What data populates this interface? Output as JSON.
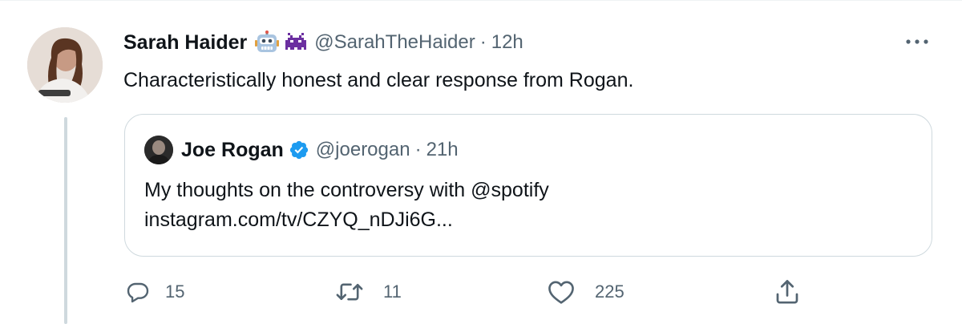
{
  "tweet": {
    "author_name": "Sarah Haider",
    "author_emojis": [
      "robot-face-emoji",
      "alien-monster-emoji"
    ],
    "author_handle": "@SarahTheHaider",
    "separator": "·",
    "time": "12h",
    "text": "Characteristically honest and clear response from Rogan."
  },
  "quoted_tweet": {
    "author_name": "Joe Rogan",
    "verified": true,
    "author_handle": "@joerogan",
    "separator": "·",
    "time": "21h",
    "text_line1": "My thoughts on the controversy with @spotify",
    "text_line2": "instagram.com/tv/CZYQ_nDJi6G..."
  },
  "actions": {
    "reply_count": "15",
    "retweet_count": "11",
    "like_count": "225"
  },
  "icons": {
    "more": "more-icon",
    "reply": "reply-icon",
    "retweet": "retweet-icon",
    "like": "like-icon",
    "share": "share-icon",
    "verified": "verified-badge-icon"
  },
  "colors": {
    "text_primary": "#0f1419",
    "text_secondary": "#536471",
    "border": "#cfd9de",
    "verified_blue": "#1d9bf0"
  }
}
